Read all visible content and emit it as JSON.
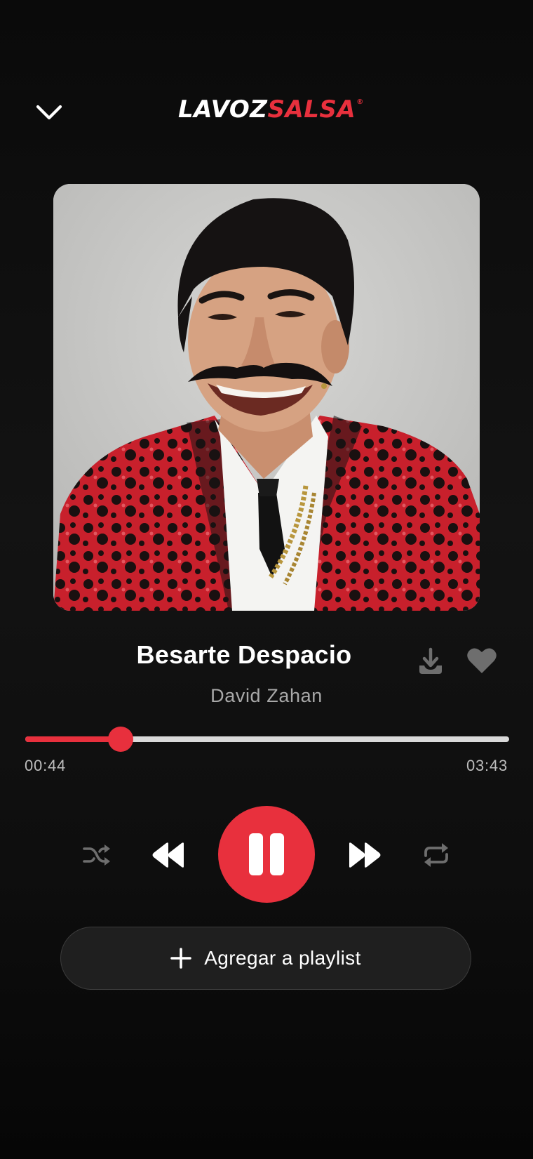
{
  "header": {
    "logo_part_a": "LAVOZ",
    "logo_part_b": "SALSA",
    "logo_reg": "®"
  },
  "track": {
    "title": "Besarte Despacio",
    "artist": "David Zahan"
  },
  "progress": {
    "elapsed": "00:44",
    "total": "03:43",
    "fraction": 0.197
  },
  "actions": {
    "add_to_playlist_label": "Agregar a playlist"
  },
  "colors": {
    "accent": "#e8303d",
    "background": "#0e0e0e",
    "icon_muted": "#6e6e6e",
    "text_secondary": "#a8a8a8"
  },
  "icons": {
    "collapse": "chevron-down-icon",
    "download": "download-icon",
    "favorite": "heart-icon",
    "shuffle": "shuffle-icon",
    "previous": "rewind-icon",
    "play_pause": "pause-icon",
    "next": "fast-forward-icon",
    "repeat": "repeat-icon",
    "add": "plus-icon"
  }
}
